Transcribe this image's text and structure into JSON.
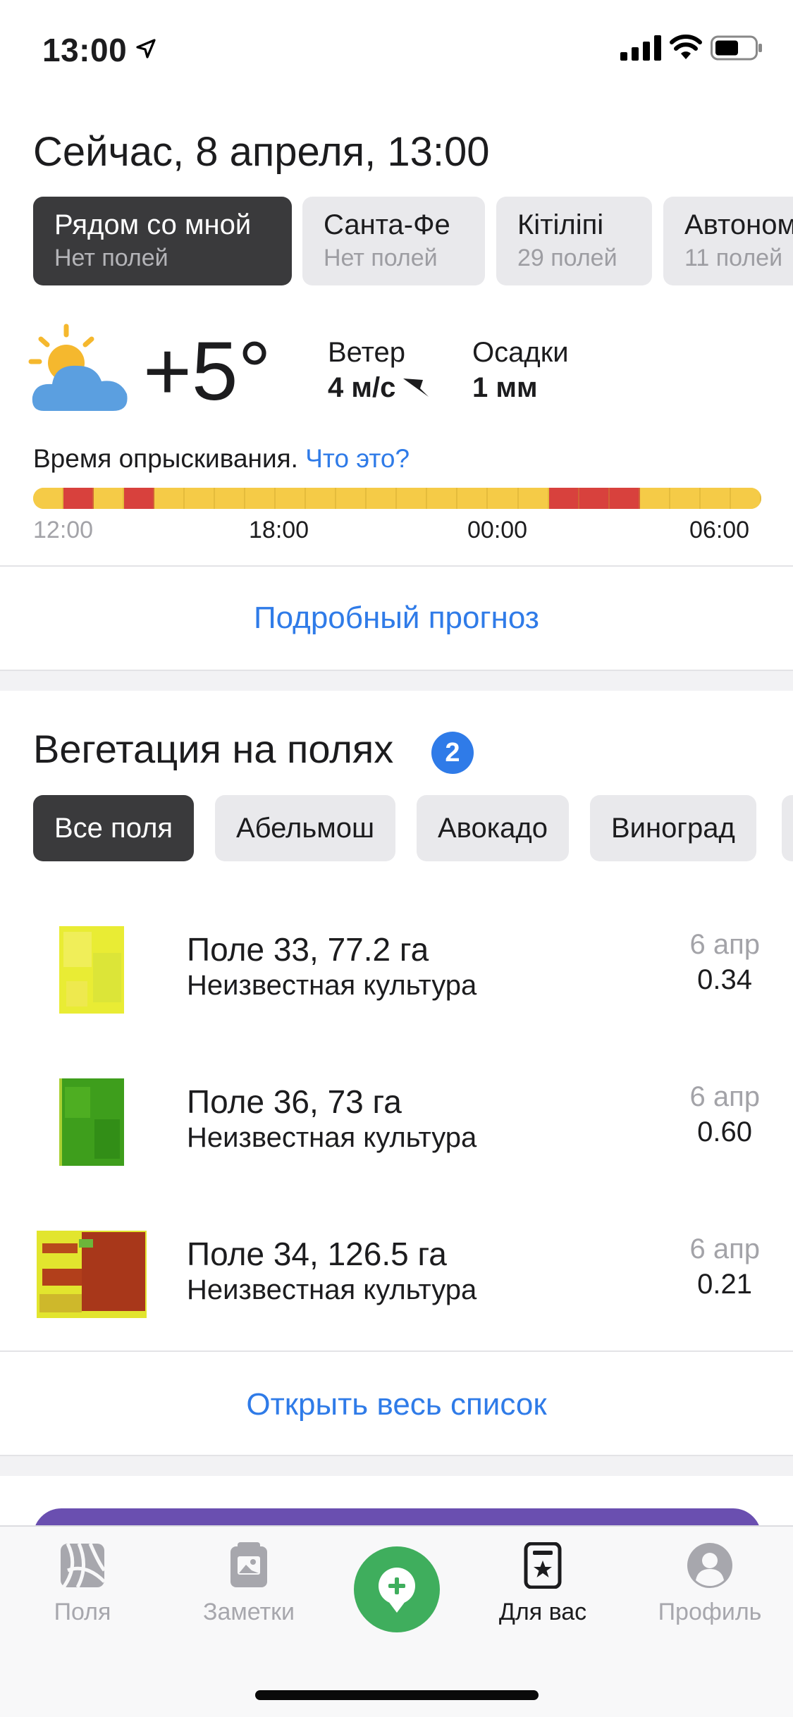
{
  "status_bar": {
    "time": "13:00"
  },
  "header": {
    "title": "Сейчас, 8 апреля, 13:00"
  },
  "locations": [
    {
      "title": "Рядом со мной",
      "sub": "Нет полей",
      "active": true
    },
    {
      "title": "Санта-Фе",
      "sub": "Нет полей",
      "active": false
    },
    {
      "title": "Кітіліпі",
      "sub": "29 полей",
      "active": false
    },
    {
      "title": "Автоном",
      "sub": "11 полей",
      "active": false
    }
  ],
  "weather": {
    "temperature": "+5°",
    "wind_label": "Ветер",
    "wind_value": "4 м/с",
    "precip_label": "Осадки",
    "precip_value": "1 мм",
    "icon": "partly-cloudy-icon"
  },
  "spray": {
    "label": "Время опрыскивания.",
    "link": "Что это?",
    "segments": [
      "good",
      "bad",
      "good",
      "bad",
      "good",
      "good",
      "good",
      "good",
      "good",
      "good",
      "good",
      "good",
      "good",
      "good",
      "good",
      "good",
      "good",
      "bad",
      "bad",
      "bad",
      "good",
      "good",
      "good",
      "good"
    ],
    "colors": {
      "good": "#f5cb47",
      "bad": "#d8413d"
    },
    "times": [
      "12:00",
      "18:00",
      "00:00",
      "06:00"
    ]
  },
  "forecast_link": "Подробный прогноз",
  "vegetation": {
    "title": "Вегетация на полях",
    "badge": "2",
    "crops": [
      "Все поля",
      "Абельмош",
      "Авокадо",
      "Виноград"
    ],
    "fields": [
      {
        "name": "Поле 33, 77.2 га",
        "crop": "Неизвестная культура",
        "date": "6 апр",
        "value": "0.34"
      },
      {
        "name": "Поле 36, 73 га",
        "crop": "Неизвестная культура",
        "date": "6 апр",
        "value": "0.60"
      },
      {
        "name": "Поле 34, 126.5 га",
        "crop": "Неизвестная культура",
        "date": "6 апр",
        "value": "0.21"
      }
    ],
    "open_all": "Открыть весь список"
  },
  "tabs": [
    {
      "label": "Поля",
      "icon": "fields-icon"
    },
    {
      "label": "Заметки",
      "icon": "notes-icon"
    },
    {
      "label": "",
      "icon": "add-note-icon"
    },
    {
      "label": "Для вас",
      "icon": "for-you-icon"
    },
    {
      "label": "Профиль",
      "icon": "profile-icon"
    }
  ],
  "colors": {
    "accent": "#2f7be8",
    "chip_active": "#3a3a3c",
    "fab": "#3fae5d",
    "promo": "#6a4fb0"
  }
}
